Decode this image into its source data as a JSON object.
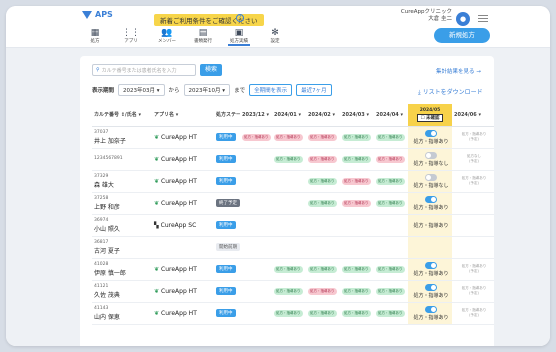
{
  "header": {
    "logo": "APS",
    "notice": "新着ご利用条件をご確認ください",
    "notice_help": "?",
    "clinic": "CureAppクリニック",
    "user": "大倉 圭二",
    "bell_icon": "bell-icon",
    "new_button": "新規処方",
    "nav": [
      {
        "label": "処方",
        "icon": "building-icon",
        "glyph": "▦"
      },
      {
        "label": "アプリ",
        "icon": "grid-icon",
        "glyph": "⋮⋮"
      },
      {
        "label": "メンバー",
        "icon": "users-icon",
        "glyph": "👥"
      },
      {
        "label": "書類発行",
        "icon": "document-icon",
        "glyph": "▤"
      },
      {
        "label": "処方実績",
        "icon": "chart-icon",
        "glyph": "▣"
      },
      {
        "label": "設定",
        "icon": "gear-icon",
        "glyph": "✻"
      }
    ]
  },
  "toolbar": {
    "search_placeholder": "カルテ番号または患者氏名を入力",
    "search_button": "検索",
    "detail_link": "集計結果を見る →",
    "period_label": "表示期間",
    "from": "2023年03月",
    "from_suffix": "から",
    "to": "2023年10月",
    "to_suffix": "まで",
    "show_all": "全期間を表示",
    "recent": "最近7ヶ月",
    "download": "リストをダウンロード"
  },
  "columns": {
    "karte": "カルテ番号 ↕/氏名 ▾",
    "app": "アプリ名 ▾",
    "status": "処方ステータス ▾",
    "months": [
      "2023/12 ▾",
      "2024/01 ▾",
      "2024/02 ▾",
      "2024/03 ▾",
      "2024/04 ▾"
    ],
    "current_month": "2024/05",
    "current_badge": "☐ 未確認",
    "next_month": "2024/06 ▾"
  },
  "rows": [
    {
      "id": "37037",
      "name": "井上 加奈子",
      "app": "CureApp HT",
      "status": "利用中",
      "status_kind": "active",
      "cells": [
        "処方・指導あり",
        "処方・指導あり",
        "処方・指導あり",
        "処方・指導あり",
        "処方・指導あり"
      ],
      "colors": [
        "red",
        "red",
        "red",
        "green",
        "green"
      ],
      "toggle": "on",
      "toggle_label": "処方・指導あり",
      "future": "処方・指導あり\n(予定)"
    },
    {
      "id": "1234567891",
      "name": "",
      "app": "CureApp HT",
      "status": "利用中",
      "status_kind": "active",
      "cells": [
        "",
        "処方・指導あり",
        "処方・指導あり",
        "処方・指導あり",
        "処方・指導あり"
      ],
      "colors": [
        "",
        "green",
        "red",
        "green",
        "red"
      ],
      "toggle": "off",
      "toggle_label": "処方・指導なし",
      "future": "処方なし\n(予定)"
    },
    {
      "id": "37329",
      "name": "森 雄大",
      "app": "CureApp HT",
      "status": "利用中",
      "status_kind": "active",
      "cells": [
        "",
        "",
        "処方・指導あり",
        "処方・指導あり",
        "処方・指導あり"
      ],
      "colors": [
        "",
        "",
        "green",
        "red",
        "green"
      ],
      "toggle": "off",
      "toggle_label": "処方・指導なし",
      "future": "処方・指導あり\n(予定)"
    },
    {
      "id": "37258",
      "name": "上野 和彦",
      "app": "CureApp HT",
      "status": "終了予定",
      "status_kind": "end",
      "cells": [
        "",
        "",
        "処方・指導あり",
        "処方・指導あり",
        "処方・指導あり"
      ],
      "colors": [
        "",
        "",
        "green",
        "red",
        "green"
      ],
      "toggle": "on",
      "toggle_label": "処方・指導あり",
      "future": ""
    },
    {
      "id": "36974",
      "name": "小山 照久",
      "app": "CureApp SC",
      "status": "利用中",
      "status_kind": "active",
      "cells": [
        "",
        "",
        "",
        "",
        ""
      ],
      "colors": [
        "",
        "",
        "",
        "",
        ""
      ],
      "toggle": "none",
      "toggle_label": "処方・指導あり",
      "future": ""
    },
    {
      "id": "36817",
      "name": "古河 夏子",
      "app": "",
      "status": "開始前期",
      "status_kind": "pending",
      "cells": [
        "",
        "",
        "",
        "",
        ""
      ],
      "colors": [
        "",
        "",
        "",
        "",
        ""
      ],
      "toggle": "none",
      "toggle_label": "",
      "future": ""
    },
    {
      "id": "41028",
      "name": "伊原 慎一郎",
      "app": "CureApp HT",
      "status": "利用中",
      "status_kind": "active",
      "cells": [
        "",
        "処方・指導あり",
        "処方・指導あり",
        "処方・指導あり",
        "処方・指導あり"
      ],
      "colors": [
        "",
        "green",
        "green",
        "green",
        "green"
      ],
      "toggle": "on",
      "toggle_label": "処方・指導あり",
      "future": "処方・指導あり\n(予定)"
    },
    {
      "id": "41121",
      "name": "久佐 茂典",
      "app": "CureApp HT",
      "status": "利用中",
      "status_kind": "active",
      "cells": [
        "",
        "処方・指導あり",
        "処方・指導あり",
        "処方・指導あり",
        "処方・指導あり"
      ],
      "colors": [
        "",
        "green",
        "red",
        "green",
        "green"
      ],
      "toggle": "on",
      "toggle_label": "処方・指導あり",
      "future": "処方・指導あり\n(予定)"
    },
    {
      "id": "41143",
      "name": "山内 保恵",
      "app": "CureApp HT",
      "status": "利用中",
      "status_kind": "active",
      "cells": [
        "",
        "処方・指導あり",
        "処方・指導あり",
        "処方・指導あり",
        "処方・指導あり"
      ],
      "colors": [
        "",
        "green",
        "green",
        "green",
        "green"
      ],
      "toggle": "on",
      "toggle_label": "処方・指導あり",
      "future": "処方・指導あり\n(予定)"
    }
  ]
}
